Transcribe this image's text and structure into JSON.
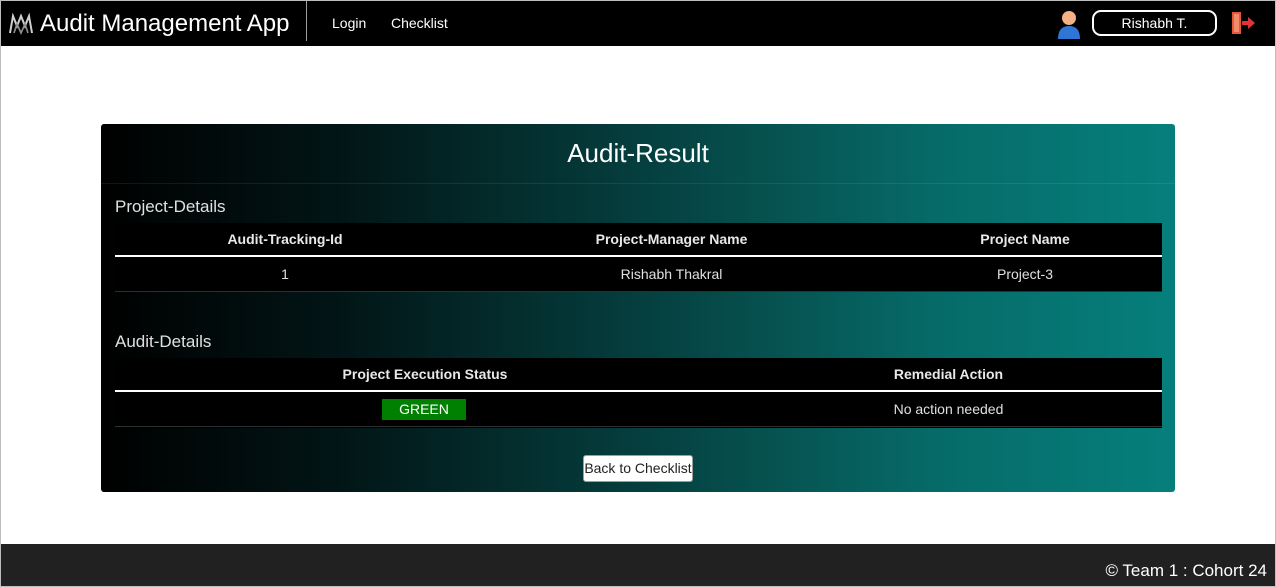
{
  "navbar": {
    "app_title": "Audit Management App",
    "links": {
      "login": "Login",
      "checklist": "Checklist"
    },
    "user_name": "Rishabh T.",
    "icons": {
      "logo": "logo-icon",
      "avatar": "user-avatar-icon",
      "logout": "logout-icon"
    }
  },
  "card": {
    "title": "Audit-Result",
    "project_section": {
      "label": "Project-Details",
      "headers": {
        "tracking_id": "Audit-Tracking-Id",
        "manager": "Project-Manager Name",
        "project": "Project Name"
      },
      "row": {
        "tracking_id": "1",
        "manager": "Rishabh Thakral",
        "project": "Project-3"
      }
    },
    "audit_section": {
      "label": "Audit-Details",
      "headers": {
        "status": "Project Execution Status",
        "remedial": "Remedial Action"
      },
      "row": {
        "status": "GREEN",
        "remedial": "No action needed"
      }
    },
    "back_button": "Back to Checklist"
  },
  "footer": {
    "text": "© Team 1 : Cohort 24"
  },
  "colors": {
    "navbar_bg": "#000000",
    "card_gradient_start": "#000000",
    "card_gradient_end": "#067f7c",
    "status_green": "#008000",
    "footer_bg": "#212121"
  }
}
